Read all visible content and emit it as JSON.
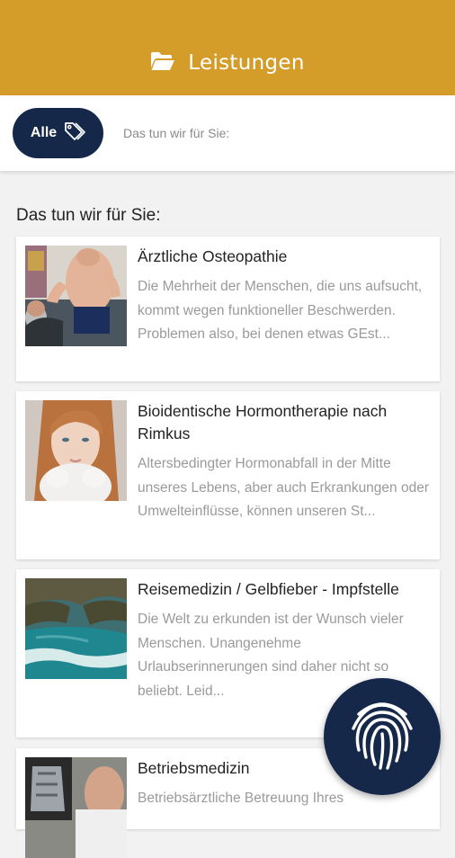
{
  "header": {
    "title": "Leistungen",
    "icon": "folder-open-icon",
    "background_color": "#d49d29"
  },
  "filter": {
    "chip_label": "Alle",
    "chip_icon": "tags-icon",
    "chip_color": "#15284a",
    "hint": "Das tun wir für Sie:"
  },
  "section_title": "Das tun wir für Sie:",
  "services": [
    {
      "title": "Ärztliche Osteopathie",
      "description": "Die Mehrheit der Menschen, die uns aufsucht, kommt wegen funktioneller Beschwerden. Problemen also, bei denen etwas GEst..."
    },
    {
      "title": "Bioidentische Hormontherapie nach Rimkus",
      "description": "Altersbedingter Hormonabfall in der Mitte unseres Lebens, aber auch Erkrankungen oder Umwelteinflüsse, können unseren St..."
    },
    {
      "title": "Reisemedizin / Gelbfieber - Impfstelle",
      "description": "Die Welt zu erkunden ist der Wunsch vieler Menschen. Unangenehme Urlaubserinnerungen sind daher nicht so beliebt. Leid..."
    },
    {
      "title": "Betriebsmedizin",
      "description": "Betriebsärztliche Betreuung Ihres"
    }
  ],
  "fab": {
    "icon": "fingerprint-icon"
  }
}
